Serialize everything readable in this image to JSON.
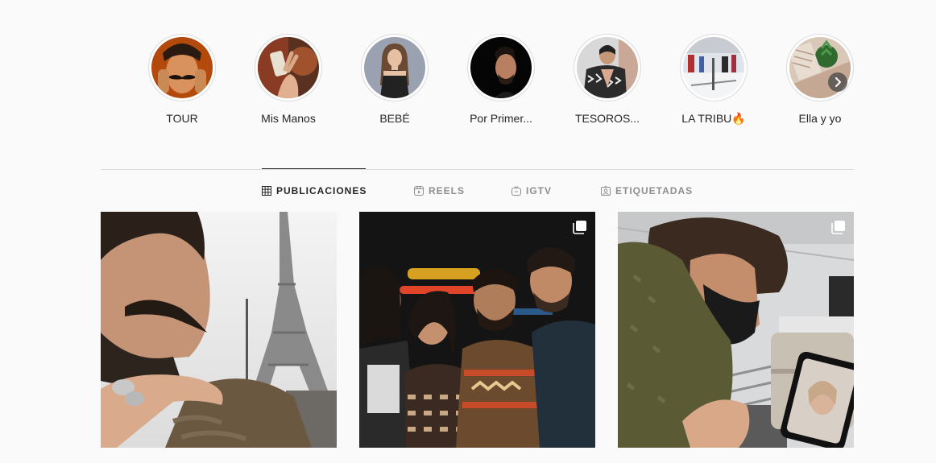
{
  "highlights": [
    {
      "label": "TOUR",
      "icon": "highlight-cover-tour"
    },
    {
      "label": "Mis Manos",
      "icon": "highlight-cover-mis-manos"
    },
    {
      "label": "BEBÉ",
      "icon": "highlight-cover-bebe"
    },
    {
      "label": "Por Primer...",
      "icon": "highlight-cover-por-primera"
    },
    {
      "label": "TESOROS...",
      "icon": "highlight-cover-tesoros"
    },
    {
      "label": "LA TRIBU🔥",
      "icon": "highlight-cover-la-tribu"
    },
    {
      "label": "Ella y yo",
      "icon": "highlight-cover-ella-y-yo"
    }
  ],
  "highlights_next_icon": "chevron-right-icon",
  "tabs": [
    {
      "label": "PUBLICACIONES",
      "icon": "grid-icon",
      "active": true
    },
    {
      "label": "REELS",
      "icon": "reels-icon",
      "active": false
    },
    {
      "label": "IGTV",
      "icon": "igtv-icon",
      "active": false
    },
    {
      "label": "ETIQUETADAS",
      "icon": "tagged-icon",
      "active": false
    }
  ],
  "posts": [
    {
      "icon": "post-photo-eiffel-selfie",
      "multi": true
    },
    {
      "icon": "post-photo-group-night",
      "multi": true
    },
    {
      "icon": "post-photo-airport-phone",
      "multi": true
    }
  ],
  "colors": {
    "background": "#fafafa",
    "text": "#262626",
    "muted": "#8e8e8e",
    "border": "#dbdbdb"
  }
}
